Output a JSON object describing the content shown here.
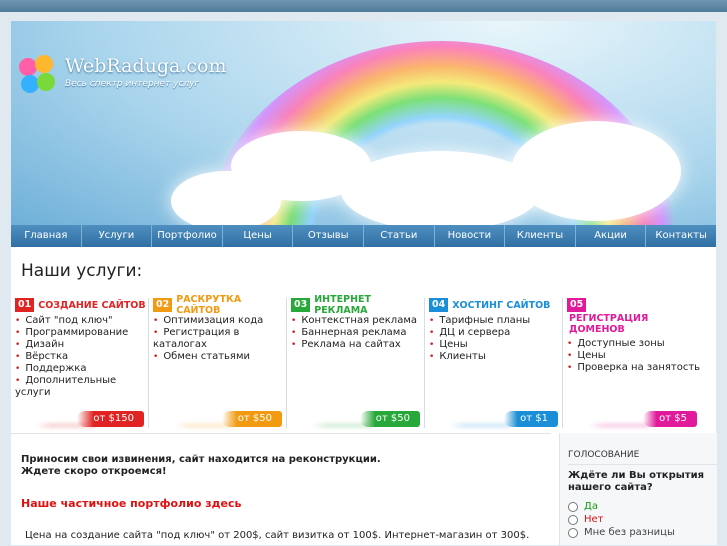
{
  "brand": {
    "title": "WebRaduga.com",
    "tagline": "Весь спектр интернет услуг"
  },
  "nav": [
    "Главная",
    "Услуги",
    "Портфолио",
    "Цены",
    "Отзывы",
    "Статьи",
    "Новости",
    "Клиенты",
    "Акции",
    "Контакты"
  ],
  "services_title": "Наши услуги:",
  "services": [
    {
      "num": "01",
      "title": "СОЗДАНИЕ САЙТОВ",
      "color": "#e02424",
      "items": [
        "Сайт \"под ключ\"",
        "Программирование",
        "Дизайн",
        "Вёрстка",
        "Поддержка",
        "Дополнительные услуги"
      ],
      "price": "от $150"
    },
    {
      "num": "02",
      "title": "РАСКРУТКА САЙТОВ",
      "color": "#f29a12",
      "items": [
        "Оптимизация кода",
        "Регистрация в каталогах",
        "Обмен статьями"
      ],
      "price": "от $50"
    },
    {
      "num": "03",
      "title": "ИНТЕРНЕТ РЕКЛАМА",
      "color": "#27a839",
      "items": [
        "Контекстная реклама",
        "Баннерная реклама",
        "Реклама на сайтах"
      ],
      "price": "от $50"
    },
    {
      "num": "04",
      "title": "ХОСТИНГ САЙТОВ",
      "color": "#1a8ed6",
      "items": [
        "Тарифные планы",
        "ДЦ и сервера",
        "Цены",
        "Клиенты"
      ],
      "price": "от $1"
    },
    {
      "num": "05",
      "title": "РЕГИСТРАЦИЯ ДОМЕНОВ",
      "color": "#e01a9a",
      "items": [
        "Доступные зоны",
        "Цены",
        "Проверка на занятость"
      ],
      "price": "от $5"
    }
  ],
  "notice": {
    "line1": "Приносим свои извинения, сайт находится на реконструкции.",
    "line2": "Ждете скоро откроемся!"
  },
  "portfolio_link": "Наше частичное портфолио здесь",
  "pricing_text": "Цена на создание сайта \"под ключ\" от 200$, сайт визитка от 100$. Интернет-магазин от 300$.",
  "poll": {
    "title": "ГОЛОСОВАНИЕ",
    "question": "Ждёте ли Вы открытия нашего сайта?",
    "options": [
      {
        "label": "Да",
        "color": "#1a9a1a"
      },
      {
        "label": "Нет",
        "color": "#d11"
      },
      {
        "label": "Мне без разницы",
        "color": "#444"
      }
    ]
  }
}
